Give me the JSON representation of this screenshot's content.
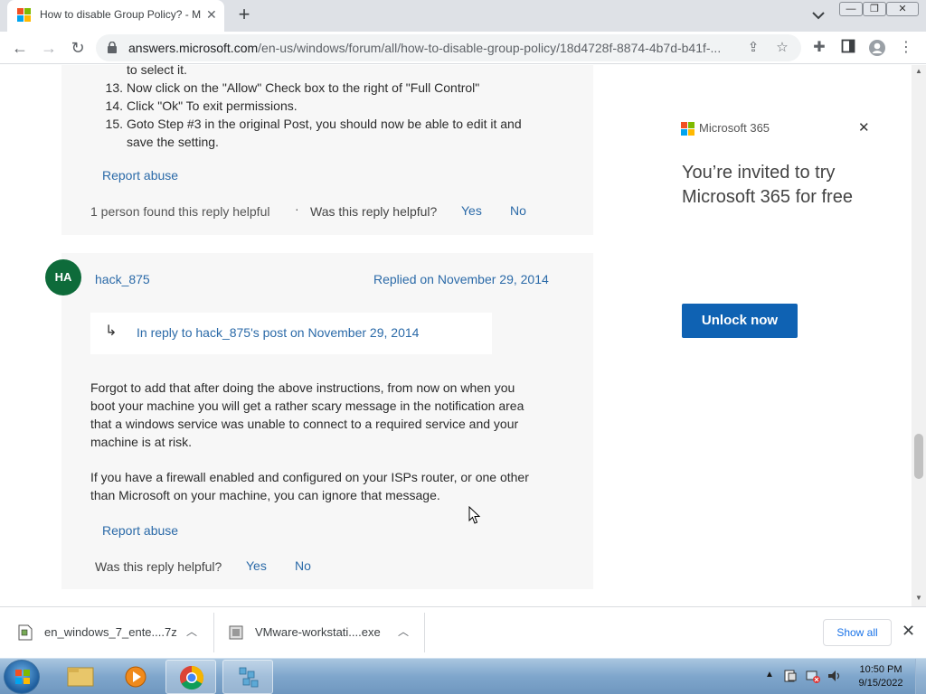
{
  "browser": {
    "tab": {
      "title": "How to disable Group Policy? - M",
      "close_glyph": "✕",
      "favicon": "microsoft-logo-icon"
    },
    "new_tab_glyph": "+",
    "window_controls": {
      "minimize": "—",
      "restore": "❐",
      "close": "✕"
    },
    "toolbar": {
      "url_domain": "answers.microsoft.com",
      "url_path": "/en-us/windows/forum/all/how-to-disable-group-policy/18d4728f-8874-4b7d-b41f-..."
    }
  },
  "page": {
    "steps": [
      {
        "num": "",
        "text": "to select it."
      },
      {
        "num": "13.",
        "text": "Now click on the \"Allow\" Check box to the right of \"Full Control\""
      },
      {
        "num": "14.",
        "text": "Click \"Ok\" To exit permissions."
      },
      {
        "num": "15.",
        "text": "Goto Step #3 in the original Post, you should now be able to edit it and"
      },
      {
        "num": "",
        "text": "save the setting."
      }
    ],
    "reply1": {
      "report_abuse": "Report abuse",
      "found_helpful": "1 person found this reply helpful",
      "separator": "·",
      "helpful_question": "Was this reply helpful?",
      "yes": "Yes",
      "no": "No"
    },
    "reply2": {
      "avatar_initials": "HA",
      "author": "hack_875",
      "date": "Replied on November 29, 2014",
      "in_reply_arrow": "↳",
      "in_reply_to": "In reply to hack_875's post on November 29, 2014",
      "paragraph1": [
        "Forgot to add that after doing the above instructions, from now on when you",
        "boot your machine you will get a rather scary message in the notification area",
        "that a windows service was unable to connect to a required service and your",
        "machine is at risk."
      ],
      "paragraph2": [
        "If you have a firewall enabled and configured on your ISPs router, or one other",
        "than Microsoft on your machine, you can ignore that message."
      ],
      "report_abuse": "Report abuse",
      "helpful_question": "Was this reply helpful?",
      "yes": "Yes",
      "no": "No"
    },
    "ad": {
      "brand": "Microsoft 365",
      "headline_line1": "You’re invited to try",
      "headline_line2": "Microsoft 365 for free",
      "cta": "Unlock now",
      "close_glyph": "✕"
    }
  },
  "downloads": {
    "items": [
      {
        "name": "en_windows_7_ente....7z",
        "icon": "archive-file-icon"
      },
      {
        "name": "VMware-workstati....exe",
        "icon": "installer-file-icon"
      }
    ],
    "show_all": "Show all",
    "close_glyph": "✕"
  },
  "taskbar": {
    "time": "10:50 PM",
    "date": "9/15/2022",
    "items": [
      "windows-explorer-icon",
      "media-player-icon",
      "chrome-icon",
      "registry-editor-icon"
    ]
  },
  "colors": {
    "link": "#2b6aa8",
    "accent_button": "#0f62b3",
    "avatar": "#0e6b3a"
  }
}
